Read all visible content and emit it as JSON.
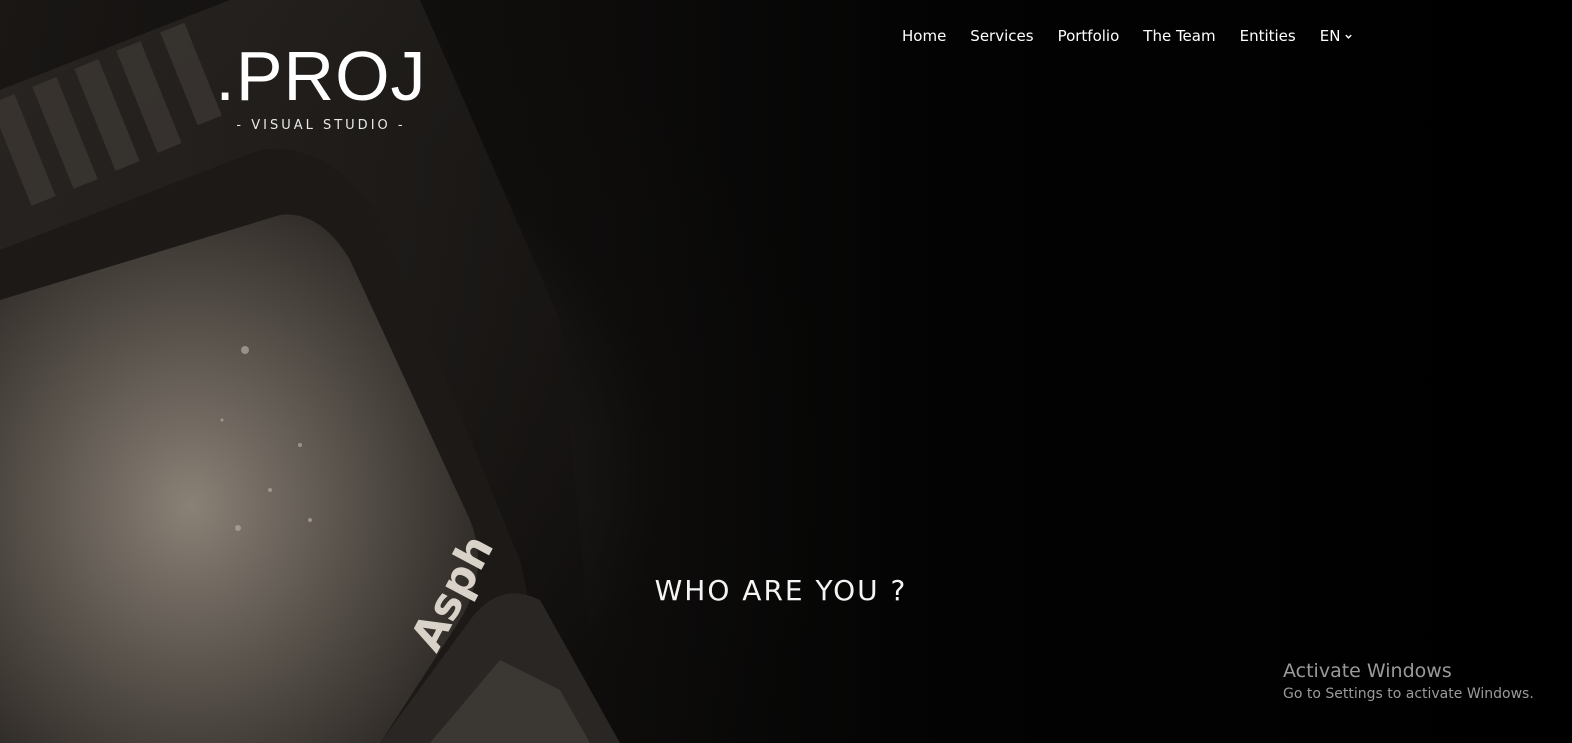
{
  "logo": {
    "main": ".PROJ",
    "sub": "- VISUAL STUDIO -"
  },
  "nav": {
    "items": [
      "Home",
      "Services",
      "Portfolio",
      "The Team",
      "Entities"
    ],
    "language": "EN"
  },
  "hero": {
    "headline": "WHO ARE YOU ?",
    "lens_text": "Asph"
  },
  "windows_watermark": {
    "title": "Activate Windows",
    "subtitle": "Go to Settings to activate Windows."
  },
  "icons": {
    "language_dropdown": "chevron-down-icon"
  }
}
